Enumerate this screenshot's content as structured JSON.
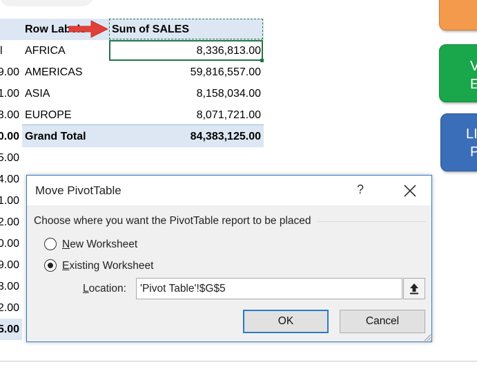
{
  "pivot": {
    "header_row_labels": "Row Labels",
    "header_sum": "Sum of SALES",
    "rows": [
      {
        "label": "AFRICA",
        "value": "8,336,813.00"
      },
      {
        "label": "AMERICAS",
        "value": "59,816,557.00"
      },
      {
        "label": "ASIA",
        "value": "8,158,034.00"
      },
      {
        "label": "EUROPE",
        "value": "8,071,721.00"
      }
    ],
    "grand_total_label": "Grand Total",
    "grand_total_value": "84,383,125.00"
  },
  "left_column": [
    "l",
    "9.00",
    "1.00",
    "3.00",
    "0.00",
    "5.00",
    "4.00",
    "1.00",
    "2.00",
    "0.00",
    "9.00",
    "3.00",
    "2.00",
    "5.00"
  ],
  "side_buttons": {
    "green_line1": "V",
    "green_line2": "E",
    "blue_line1": "LIS",
    "blue_line2": "P"
  },
  "dialog": {
    "title": "Move PivotTable",
    "help": "?",
    "prompt": "Choose where you want the PivotTable report to be placed",
    "option_new_prefix": "N",
    "option_new_rest": "ew Worksheet",
    "option_existing_prefix": "E",
    "option_existing_rest": "xisting Worksheet",
    "selected_option": "existing",
    "location_label_prefix": "L",
    "location_label_rest": "ocation:",
    "location_value": "'Pivot Table'!$G$5",
    "ok_label": "OK",
    "cancel_label": "Cancel"
  },
  "colors": {
    "pivot_header_fill": "#dde7f3",
    "selection_green": "#217346",
    "arrow_red": "#e0403a",
    "dialog_border": "#2b79c6"
  }
}
